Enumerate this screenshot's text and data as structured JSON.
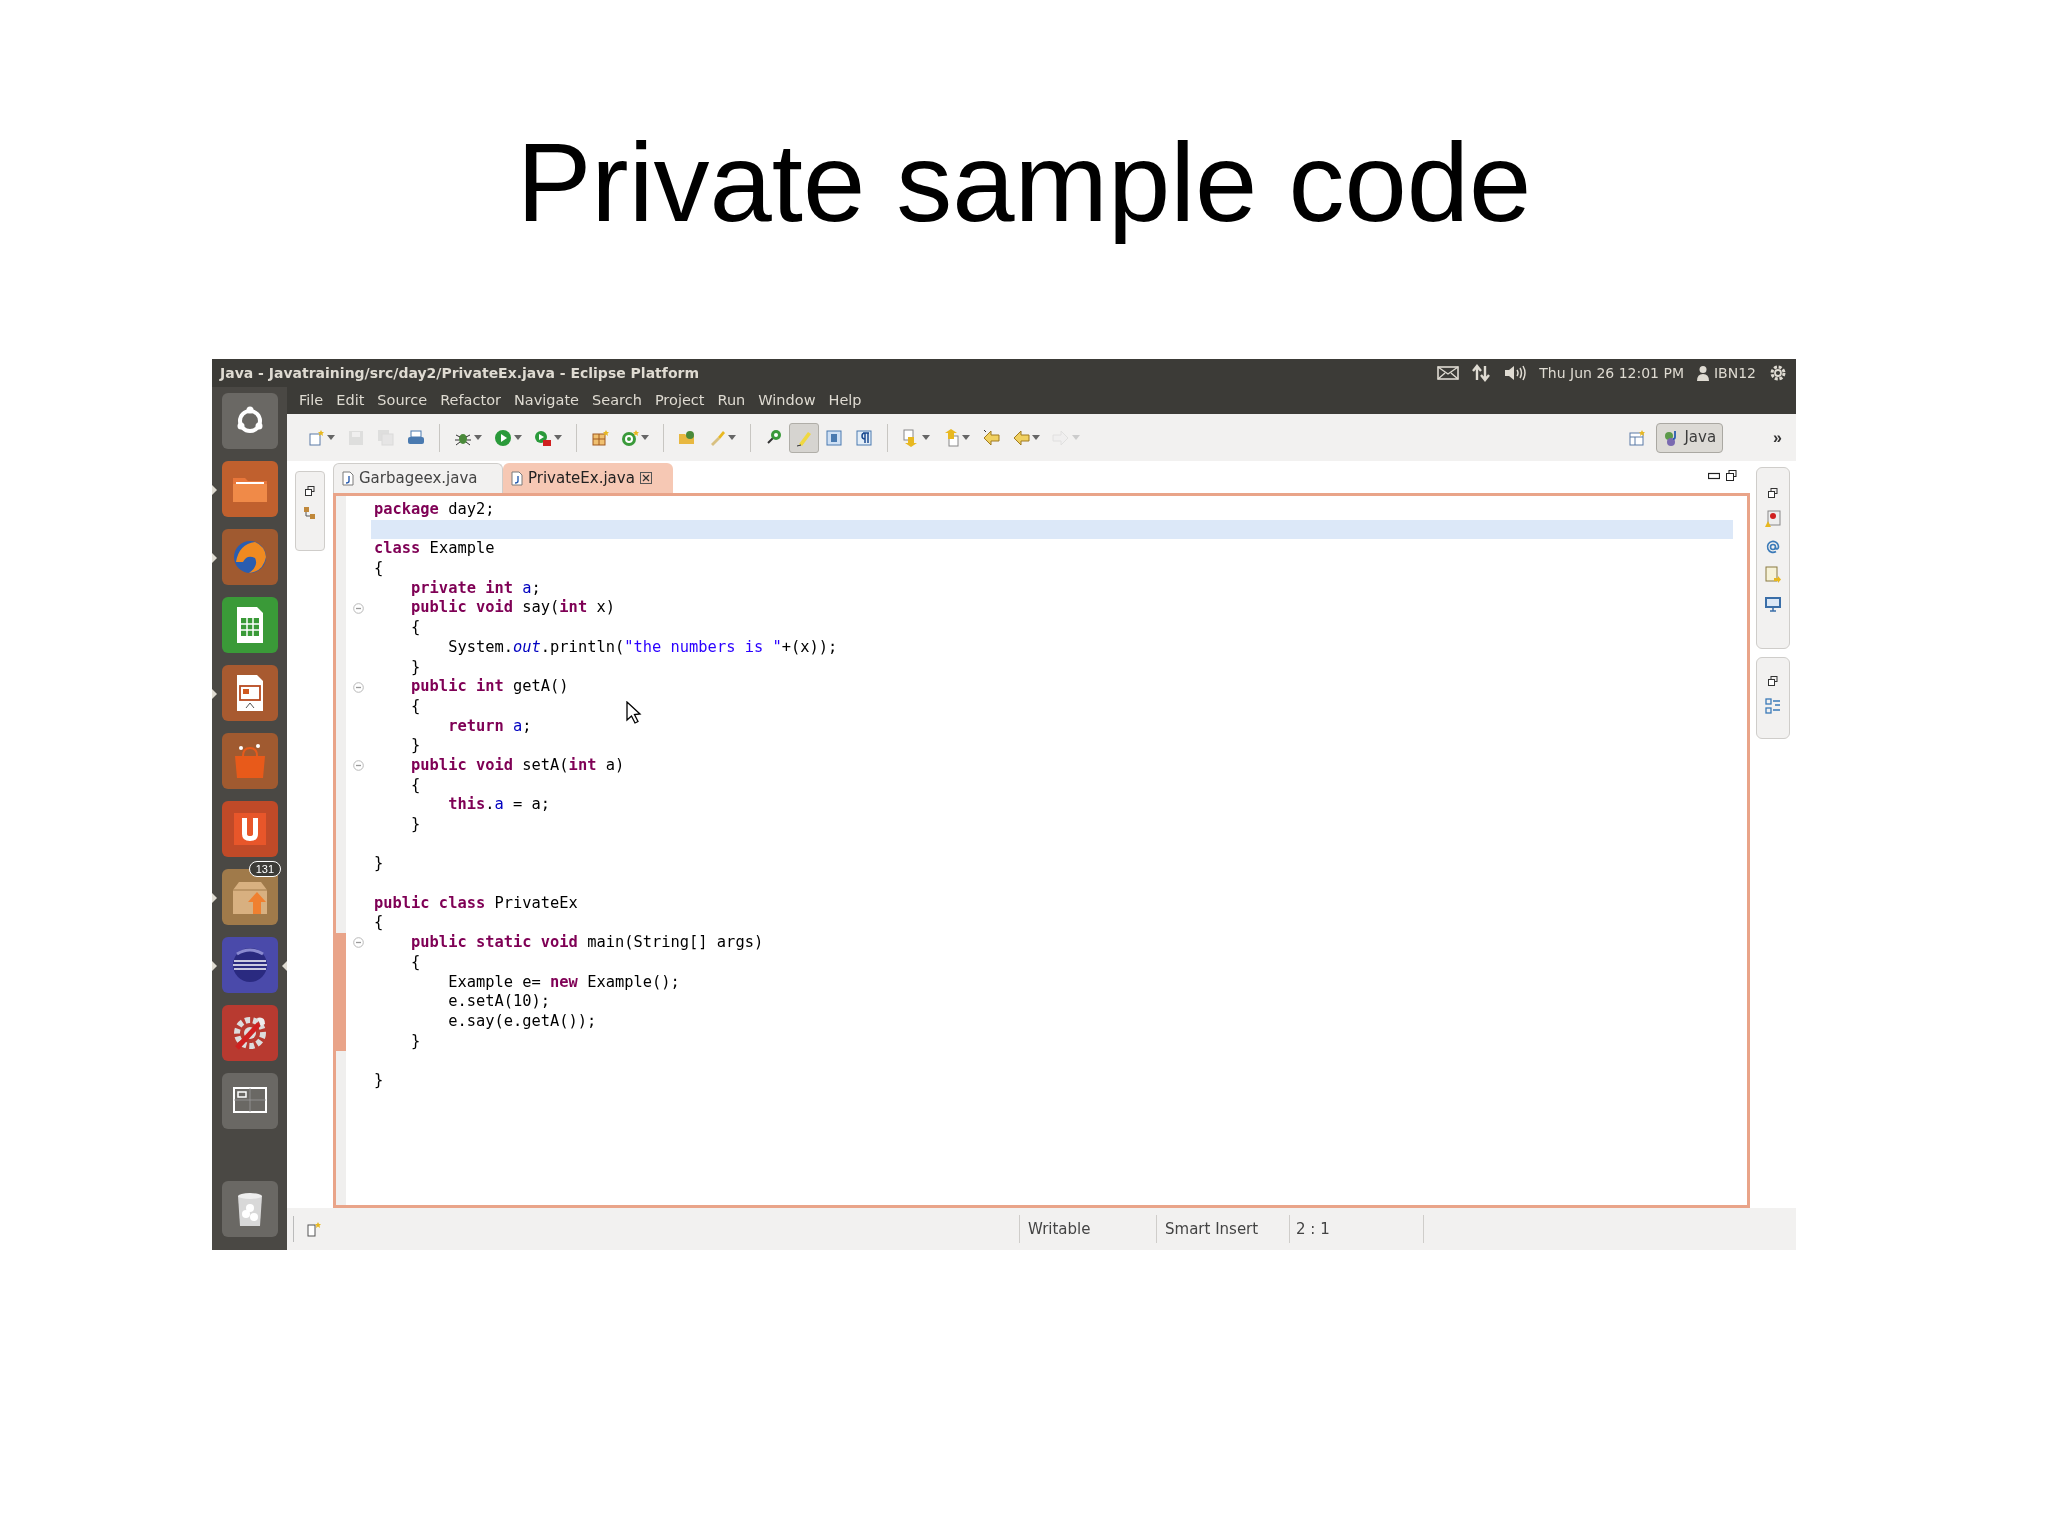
{
  "slide_title": "Private sample code",
  "window": {
    "title": "Java - Javatraining/src/day2/PrivateEx.java - Eclipse Platform"
  },
  "panel": {
    "clock": "Thu Jun 26 12:01 PM",
    "user": "IBN12"
  },
  "menu": [
    "File",
    "Edit",
    "Source",
    "Refactor",
    "Navigate",
    "Search",
    "Project",
    "Run",
    "Window",
    "Help"
  ],
  "launcher": [
    {
      "running": false,
      "active": false
    },
    {
      "running": true,
      "active": false
    },
    {
      "running": true,
      "active": false
    },
    {
      "running": false,
      "active": false
    },
    {
      "running": true,
      "active": false
    },
    {
      "running": false,
      "active": false
    },
    {
      "running": false,
      "active": false
    },
    {
      "running": true,
      "active": false,
      "badge": "131"
    },
    {
      "running": true,
      "active": true
    },
    {
      "running": false,
      "active": false
    },
    {
      "running": false,
      "active": false
    },
    {
      "running": false,
      "active": false
    }
  ],
  "toolbar": [
    [
      {
        "kind": "dropdown",
        "disabled": false,
        "pressed": false
      },
      {
        "kind": "button",
        "disabled": true,
        "pressed": false
      },
      {
        "kind": "button",
        "disabled": true,
        "pressed": false
      },
      {
        "kind": "button",
        "disabled": false,
        "pressed": false
      }
    ],
    [
      {
        "kind": "dropdown",
        "disabled": false,
        "pressed": false
      },
      {
        "kind": "dropdown",
        "disabled": false,
        "pressed": false
      },
      {
        "kind": "dropdown",
        "disabled": false,
        "pressed": false
      }
    ],
    [
      {
        "kind": "button",
        "disabled": false,
        "pressed": false
      },
      {
        "kind": "dropdown",
        "disabled": false,
        "pressed": false
      }
    ],
    [
      {
        "kind": "button",
        "disabled": false,
        "pressed": false
      },
      {
        "kind": "dropdown",
        "disabled": false,
        "pressed": false
      }
    ],
    [
      {
        "kind": "button",
        "disabled": false,
        "pressed": false
      },
      {
        "kind": "button",
        "disabled": false,
        "pressed": true
      },
      {
        "kind": "button",
        "disabled": false,
        "pressed": false
      },
      {
        "kind": "button",
        "disabled": false,
        "pressed": false
      }
    ],
    [
      {
        "kind": "dropdown",
        "disabled": false,
        "pressed": false
      },
      {
        "kind": "dropdown",
        "disabled": false,
        "pressed": false
      },
      {
        "kind": "button",
        "disabled": false,
        "pressed": false
      },
      {
        "kind": "dropdown",
        "disabled": false,
        "pressed": false
      },
      {
        "kind": "dropdown",
        "disabled": true,
        "pressed": false
      }
    ]
  ],
  "perspective": {
    "label": "Java",
    "selected": true,
    "more": "»"
  },
  "tabs": [
    {
      "label": "Garbageex.java",
      "selected": false
    },
    {
      "label": "PrivateEx.java",
      "selected": true
    }
  ],
  "code": [
    {
      "fold": false,
      "current": false,
      "in_range": false,
      "segments": [
        {
          "kind": "keyword",
          "text": "package"
        },
        {
          "kind": "plain",
          "text": " day2;"
        }
      ]
    },
    {
      "fold": false,
      "current": true,
      "in_range": false
    },
    {
      "fold": false,
      "current": false,
      "in_range": false,
      "segments": [
        {
          "kind": "keyword",
          "text": "class"
        },
        {
          "kind": "plain",
          "text": " Example"
        }
      ]
    },
    {
      "fold": false,
      "current": false,
      "in_range": false,
      "segments": [
        {
          "kind": "plain",
          "text": "{"
        }
      ]
    },
    {
      "fold": false,
      "current": false,
      "in_range": false,
      "segments": [
        {
          "kind": "keyword",
          "text": "    private int "
        },
        {
          "kind": "field",
          "text": "a"
        },
        {
          "kind": "plain",
          "text": ";"
        }
      ]
    },
    {
      "fold": true,
      "current": false,
      "in_range": false,
      "segments": [
        {
          "kind": "keyword",
          "text": "    public void"
        },
        {
          "kind": "plain",
          "text": " say("
        },
        {
          "kind": "keyword",
          "text": "int"
        },
        {
          "kind": "plain",
          "text": " x)"
        }
      ]
    },
    {
      "fold": false,
      "current": false,
      "in_range": false,
      "segments": [
        {
          "kind": "plain",
          "text": "    {"
        }
      ]
    },
    {
      "fold": false,
      "current": false,
      "in_range": false,
      "segments": [
        {
          "kind": "plain",
          "text": "        System."
        },
        {
          "kind": "static",
          "text": "out"
        },
        {
          "kind": "plain",
          "text": ".println("
        },
        {
          "kind": "string",
          "text": "\"the numbers is \""
        },
        {
          "kind": "plain",
          "text": "+(x));"
        }
      ]
    },
    {
      "fold": false,
      "current": false,
      "in_range": false,
      "segments": [
        {
          "kind": "plain",
          "text": "    }"
        }
      ]
    },
    {
      "fold": true,
      "current": false,
      "in_range": false,
      "segments": [
        {
          "kind": "keyword",
          "text": "    public int"
        },
        {
          "kind": "plain",
          "text": " getA()"
        }
      ]
    },
    {
      "fold": false,
      "current": false,
      "in_range": false,
      "segments": [
        {
          "kind": "plain",
          "text": "    {"
        }
      ]
    },
    {
      "fold": false,
      "current": false,
      "in_range": false,
      "segments": [
        {
          "kind": "keyword",
          "text": "        return "
        },
        {
          "kind": "field",
          "text": "a"
        },
        {
          "kind": "plain",
          "text": ";"
        }
      ]
    },
    {
      "fold": false,
      "current": false,
      "in_range": false,
      "segments": [
        {
          "kind": "plain",
          "text": "    }"
        }
      ]
    },
    {
      "fold": true,
      "current": false,
      "in_range": false,
      "segments": [
        {
          "kind": "keyword",
          "text": "    public void"
        },
        {
          "kind": "plain",
          "text": " setA("
        },
        {
          "kind": "keyword",
          "text": "int"
        },
        {
          "kind": "plain",
          "text": " a)"
        }
      ]
    },
    {
      "fold": false,
      "current": false,
      "in_range": false,
      "segments": [
        {
          "kind": "plain",
          "text": "    {"
        }
      ]
    },
    {
      "fold": false,
      "current": false,
      "in_range": false,
      "segments": [
        {
          "kind": "keyword",
          "text": "        this"
        },
        {
          "kind": "plain",
          "text": "."
        },
        {
          "kind": "field",
          "text": "a"
        },
        {
          "kind": "plain",
          "text": " = a;"
        }
      ]
    },
    {
      "fold": false,
      "current": false,
      "in_range": false,
      "segments": [
        {
          "kind": "plain",
          "text": "    }"
        }
      ]
    },
    {
      "fold": false,
      "current": false,
      "in_range": false
    },
    {
      "fold": false,
      "current": false,
      "in_range": false,
      "segments": [
        {
          "kind": "plain",
          "text": "}"
        }
      ]
    },
    {
      "fold": false,
      "current": false,
      "in_range": false
    },
    {
      "fold": false,
      "current": false,
      "in_range": false,
      "segments": [
        {
          "kind": "keyword",
          "text": "public class"
        },
        {
          "kind": "plain",
          "text": " PrivateEx"
        }
      ]
    },
    {
      "fold": false,
      "current": false,
      "in_range": false,
      "segments": [
        {
          "kind": "plain",
          "text": "{"
        }
      ]
    },
    {
      "fold": true,
      "current": false,
      "in_range": true,
      "segments": [
        {
          "kind": "keyword",
          "text": "    public static void"
        },
        {
          "kind": "plain",
          "text": " main(String[] args)"
        }
      ]
    },
    {
      "fold": false,
      "current": false,
      "in_range": true,
      "segments": [
        {
          "kind": "plain",
          "text": "    {"
        }
      ]
    },
    {
      "fold": false,
      "current": false,
      "in_range": true,
      "segments": [
        {
          "kind": "plain",
          "text": "        Example e= "
        },
        {
          "kind": "keyword",
          "text": "new"
        },
        {
          "kind": "plain",
          "text": " Example();"
        }
      ]
    },
    {
      "fold": false,
      "current": false,
      "in_range": true,
      "segments": [
        {
          "kind": "plain",
          "text": "        e.setA(10);"
        }
      ]
    },
    {
      "fold": false,
      "current": false,
      "in_range": true,
      "segments": [
        {
          "kind": "plain",
          "text": "        e.say(e.getA());"
        }
      ]
    },
    {
      "fold": false,
      "current": false,
      "in_range": true,
      "segments": [
        {
          "kind": "plain",
          "text": "    }"
        }
      ]
    },
    {
      "fold": false,
      "current": false,
      "in_range": false
    },
    {
      "fold": false,
      "current": false,
      "in_range": false,
      "segments": [
        {
          "kind": "plain",
          "text": "}"
        }
      ]
    }
  ],
  "status_bar": {
    "mode": "Writable",
    "insert": "Smart Insert",
    "position": "2 : 1"
  }
}
